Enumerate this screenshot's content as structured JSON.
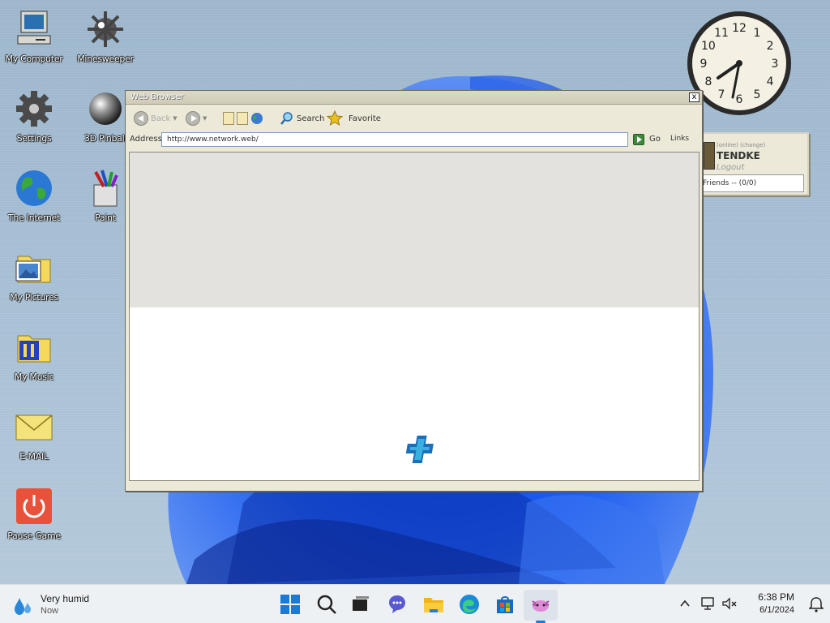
{
  "desktop": {
    "icons": [
      {
        "label": "My Computer"
      },
      {
        "label": "Minesweeper"
      },
      {
        "label": "Settings"
      },
      {
        "label": "3D Pinball"
      },
      {
        "label": "The Internet"
      },
      {
        "label": "Paint"
      },
      {
        "label": "My Pictures"
      },
      {
        "label": "My Music"
      },
      {
        "label": "E-MAIL"
      },
      {
        "label": "Pause Game"
      }
    ],
    "clock": {
      "numerals": [
        "12",
        "1",
        "2",
        "3",
        "4",
        "5",
        "6",
        "7",
        "8",
        "9",
        "10",
        "11"
      ],
      "hour_hand_time": "6:38"
    }
  },
  "messenger": {
    "small_text": "(online) (change)",
    "username": "TENDKE",
    "logout_label": "Logout",
    "friends_label": "Friends -- (0/0)"
  },
  "browser": {
    "title": "Web Browser",
    "close_label": "x",
    "toolbar": {
      "back_label": "Back",
      "search_label": "Search",
      "favorite_label": "Favorite"
    },
    "address_label": "Address",
    "address_value": "http://www.network.web/",
    "go_label": "Go",
    "links_label": "Links"
  },
  "taskbar": {
    "weather_title": "Very humid",
    "weather_sub": "Now",
    "time": "6:38 PM",
    "date": "6/1/2024"
  }
}
